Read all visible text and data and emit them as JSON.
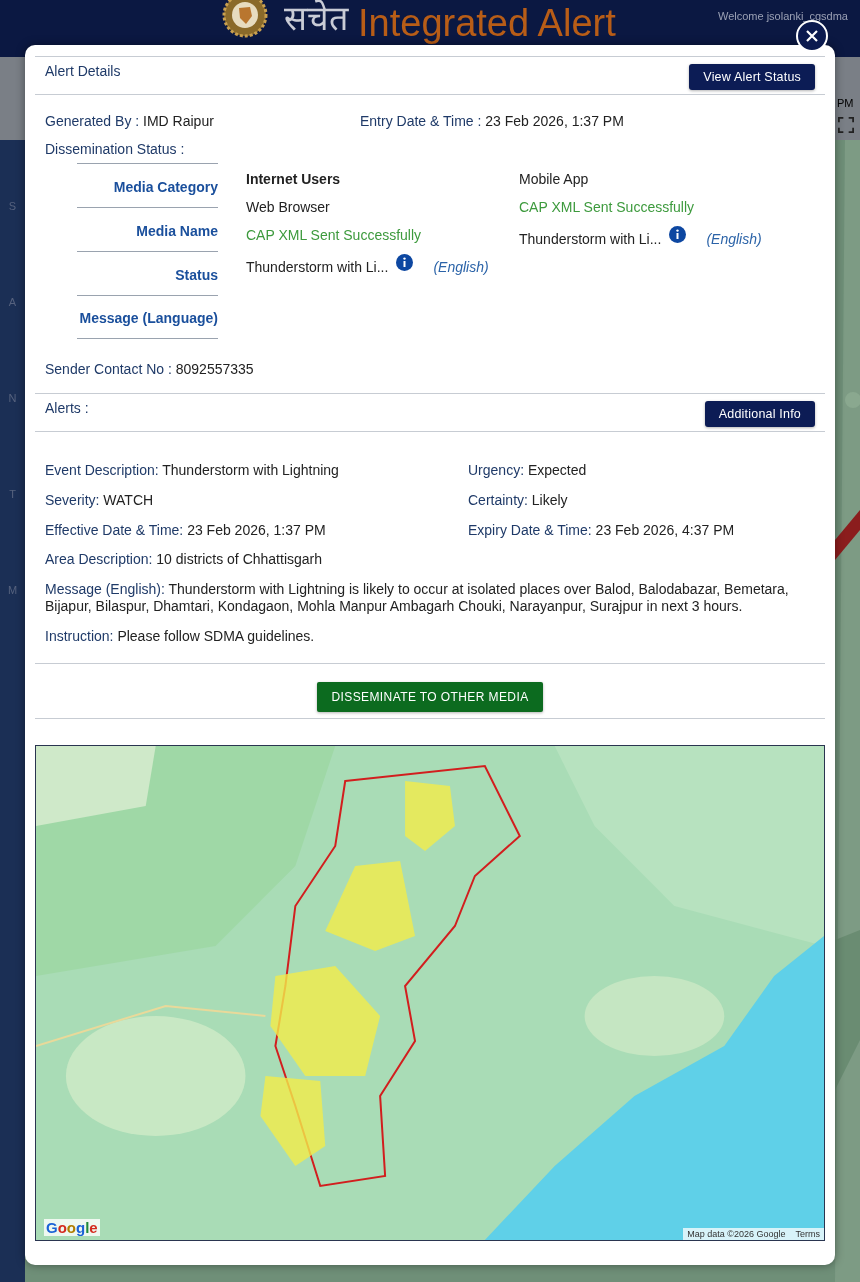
{
  "header": {
    "logo_text": "सचेत",
    "title": "Integrated Alert",
    "welcome": "Welcome jsolanki_cgsdma"
  },
  "toolbar": {
    "time_suffix": "PM"
  },
  "sidebar": {
    "items": [
      "S",
      "A",
      "N",
      "T",
      "M"
    ]
  },
  "modal": {
    "title": "Alert Details",
    "status_button": "View Alert Status",
    "info": [
      {
        "label": "Generated By :",
        "value": "IMD Raipur"
      },
      {
        "label": "Entry Date & Time :",
        "value": "23 Feb 2026, 1:37 PM"
      }
    ],
    "dissemination_label": "Dissemination Status :",
    "row_labels": [
      "Media Category",
      "Media Name",
      "Status",
      "Message (Language)"
    ],
    "media": [
      {
        "category": "Internet Users",
        "selected": true,
        "name": "Web Browser",
        "status": "CAP XML Sent Successfully",
        "message": "Thunderstorm with Li...",
        "language": "(English)"
      },
      {
        "category": "Mobile App",
        "selected": false,
        "status": "CAP XML Sent Successfully",
        "message": "Thunderstorm with Li...",
        "language": "(English)"
      }
    ],
    "sender": {
      "label": "Sender Contact No :",
      "value": "8092557335"
    },
    "alerts_label": "Alerts :",
    "info_button": "Additional Info",
    "fields": [
      {
        "left": {
          "label": "Event Description:",
          "value": "Thunderstorm with Lightning"
        },
        "right": {
          "label": "Urgency:",
          "value": "Expected"
        }
      },
      {
        "left": {
          "label": "Severity:",
          "value": "WATCH"
        },
        "right": {
          "label": "Certainty:",
          "value": "Likely"
        }
      },
      {
        "left": {
          "label": "Effective Date & Time:",
          "value": "23 Feb 2026, 1:37 PM"
        },
        "right": {
          "label": "Expiry Date & Time:",
          "value": "23 Feb 2026, 4:37 PM"
        }
      },
      {
        "left": {
          "label": "Area Description:",
          "value": "10 districts of Chhattisgarh"
        }
      },
      {
        "left": {
          "label": "Message (English):",
          "value": "Thunderstorm with Lightning is likely to occur at isolated places over Balod, Balodabazar, Bemetara, Bijapur, Bilaspur, Dhamtari, Kondagaon, Mohla Manpur Ambagarh Chouki, Narayanpur, Surajpur in next 3 hours."
        }
      },
      {
        "left": {
          "label": "Instruction:",
          "value": "Please follow SDMA guidelines."
        }
      }
    ],
    "disseminate_button": "DISSEMINATE TO OTHER MEDIA",
    "map": {
      "kind": "picture",
      "logo": "Google",
      "attribution": "Map data ©2026 Google",
      "terms": "Terms"
    }
  }
}
